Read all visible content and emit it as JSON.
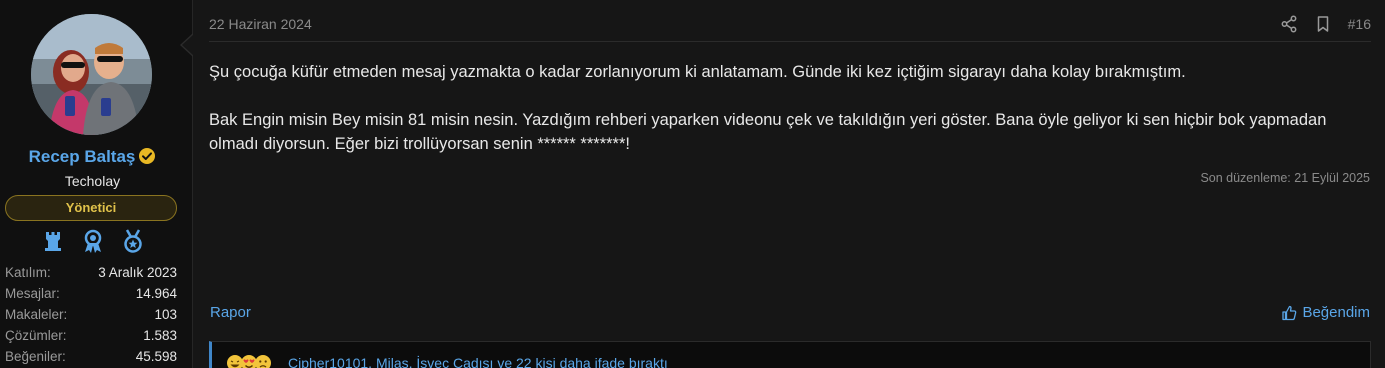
{
  "user": {
    "name": "Recep Baltaş",
    "title": "Techolay",
    "role_badge": "Yönetici",
    "trophy_icons": [
      "tower-icon",
      "award-ribbon-icon",
      "medal-icon"
    ],
    "stats": [
      {
        "label": "Katılım:",
        "value": "3 Aralık 2023"
      },
      {
        "label": "Mesajlar:",
        "value": "14.964"
      },
      {
        "label": "Makaleler:",
        "value": "103"
      },
      {
        "label": "Çözümler:",
        "value": "1.583"
      },
      {
        "label": "Beğeniler:",
        "value": "45.598"
      }
    ]
  },
  "post": {
    "date": "22 Haziran 2024",
    "number": "#16",
    "paragraphs": [
      "Şu çocuğa küfür etmeden mesaj yazmakta o kadar zorlanıyorum ki anlatamam. Günde iki kez içtiğim sigarayı daha kolay bırakmıştım.",
      "Bak Engin misin Bey misin 81 misin nesin. Yazdığım rehberi yaparken videonu çek ve takıldığın yeri göster. Bana öyle geliyor ki sen hiçbir bok yapmadan olmadı diyorsun. Eğer bizi trollüyorsan senin ****** *******!"
    ],
    "last_edited": "Son düzenleme: 21 Eylül 2025",
    "report_label": "Rapor",
    "like_label": "Beğendim",
    "reactions_text": "Cipher10101, Milas, İsveç Cadısı ve 22 kişi daha ifade bıraktı"
  },
  "colors": {
    "accent": "#5aa6e8",
    "badge_gold": "#e0c24a",
    "background": "#161616",
    "sidebar": "#101010"
  }
}
